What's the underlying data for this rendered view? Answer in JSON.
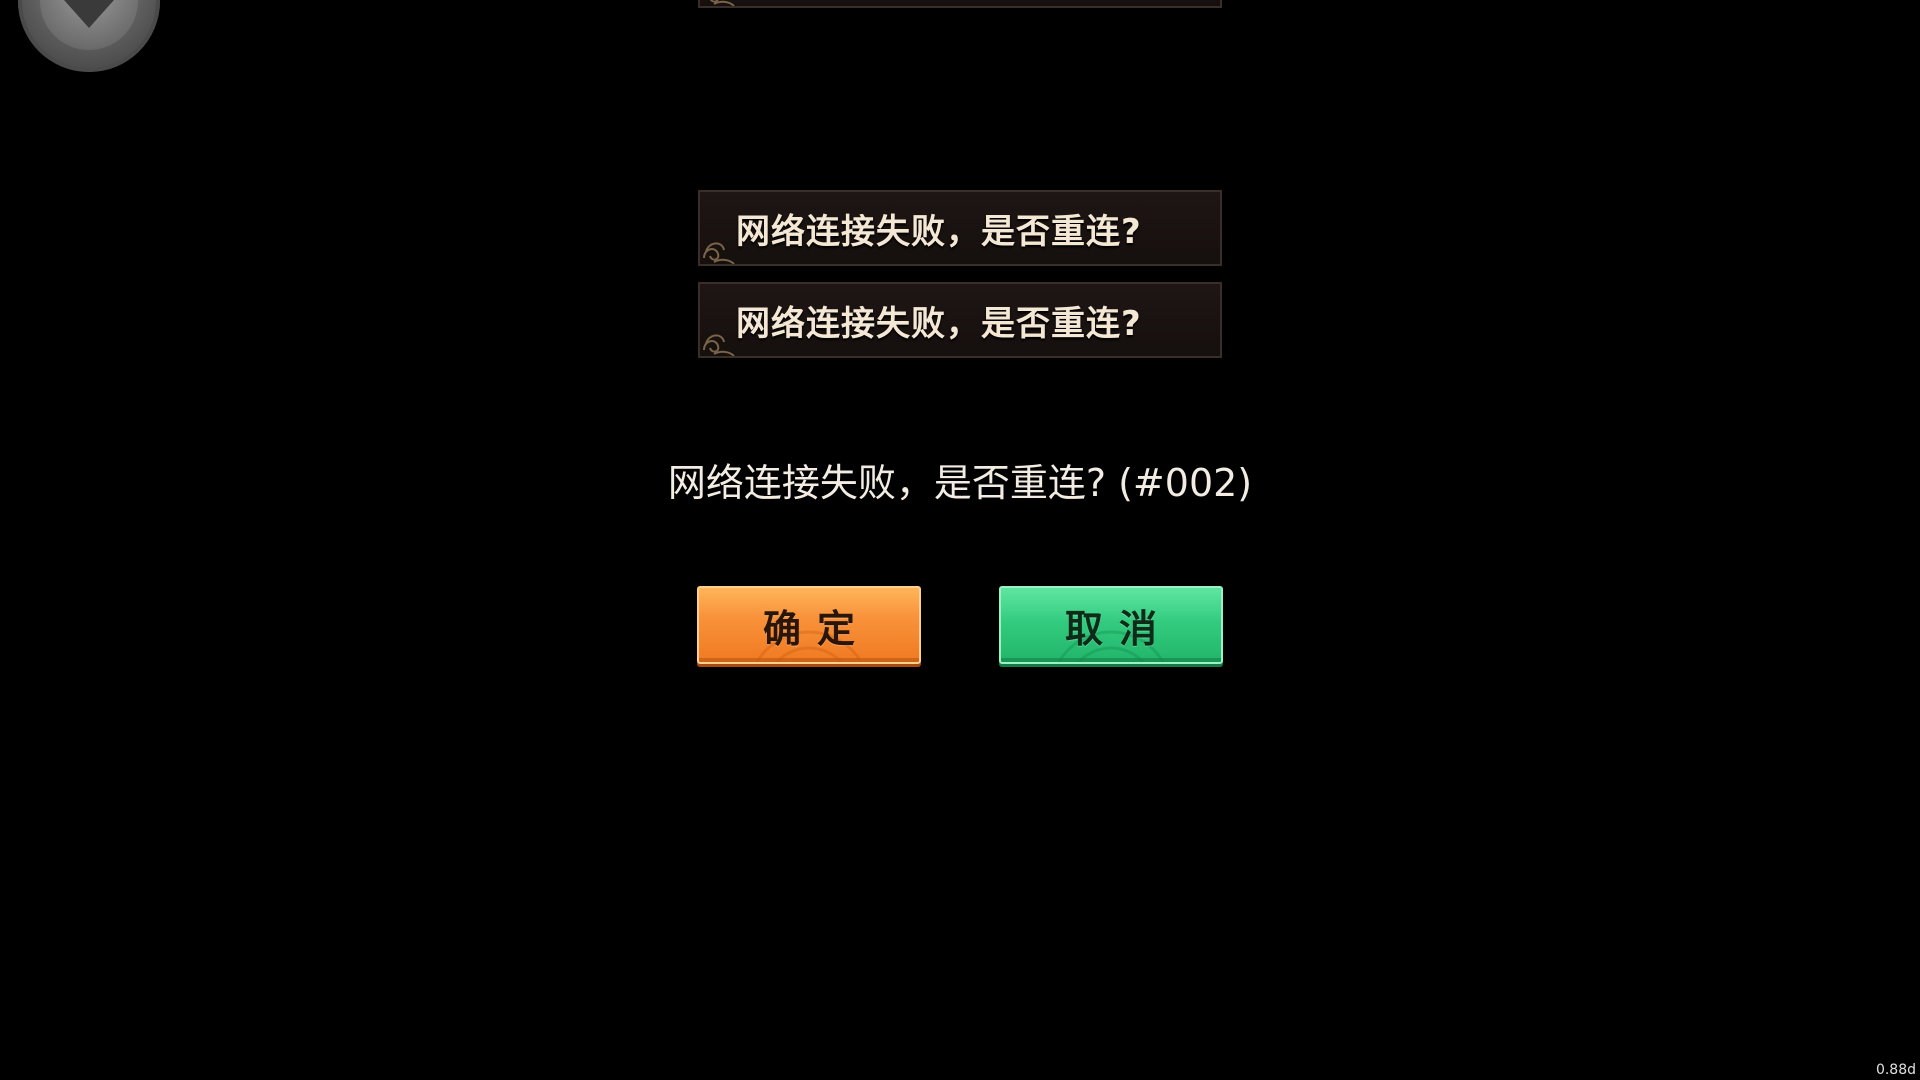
{
  "banners": [
    {
      "text": ""
    },
    {
      "text": "网络连接失败，是否重连?"
    },
    {
      "text": "网络连接失败，是否重连?"
    }
  ],
  "dialog": {
    "message": "网络连接失败，是否重连? (#002)",
    "confirm_label": "确定",
    "cancel_label": "取消"
  },
  "version": "0.88d",
  "colors": {
    "background": "#000000",
    "confirm_button": "#f8923a",
    "cancel_button": "#33cc7f",
    "banner_text": "#f4e8d4"
  },
  "icons": {
    "float_button": "down-arrow-icon",
    "banner_decor": "cloud-swirl-icon"
  }
}
